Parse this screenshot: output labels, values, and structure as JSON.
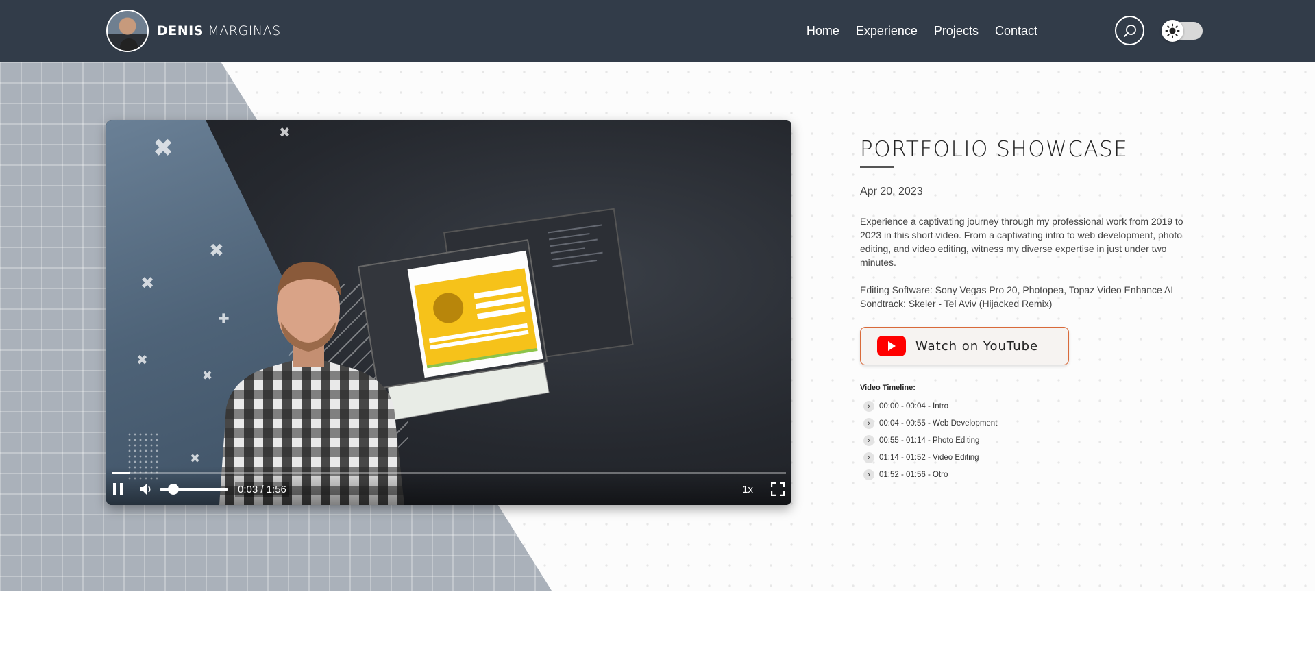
{
  "header": {
    "brand_first": "DENIS",
    "brand_last": "MARGINAS",
    "nav": [
      {
        "label": "Home"
      },
      {
        "label": "Experience"
      },
      {
        "label": "Projects"
      },
      {
        "label": "Contact"
      }
    ],
    "search_icon": "search-icon",
    "theme_toggle_icon": "sun-icon"
  },
  "video": {
    "time_display": "0:03 / 1:56",
    "speed": "1x",
    "progress": 0.026,
    "volume": 0.12,
    "state": "playing"
  },
  "info": {
    "title": "PORTFOLIO SHOWCASE",
    "date": "Apr 20, 2023",
    "description": "Experience a captivating journey through my professional work from 2019 to 2023 in this short video. From a captivating intro to web development, photo editing, and video editing, witness my diverse expertise in just under two minutes.",
    "software_line": "Editing Software: Sony Vegas Pro 20, Photopea, Topaz Video Enhance AI",
    "soundtrack_line": "Sondtrack: Skeler - Tel Aviv (Hijacked Remix)",
    "youtube_label": "Watch on YouTube",
    "timeline_title": "Video Timeline:",
    "timeline": [
      {
        "label": "00:00 - 00:04 - Intro"
      },
      {
        "label": "00:04 - 00:55 - Web Development"
      },
      {
        "label": "00:55 - 01:14 - Photo Editing"
      },
      {
        "label": "01:14 - 01:52 - Video Editing"
      },
      {
        "label": "01:52 - 01:56 - Otro"
      }
    ]
  },
  "colors": {
    "header_bg": "#323c49",
    "youtube_red": "#ff0000",
    "button_border": "#d96a3a"
  }
}
